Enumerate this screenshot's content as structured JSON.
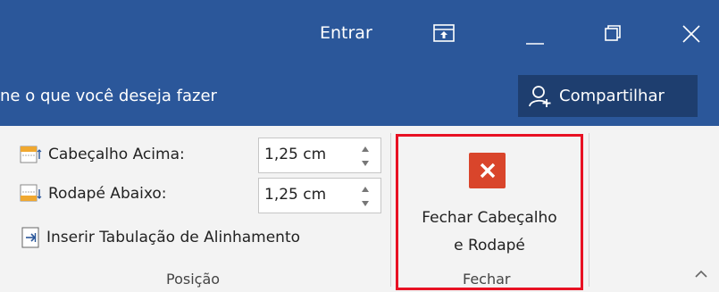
{
  "titlebar": {
    "signin_label": "Entrar",
    "icons": [
      "ribbon-display-icon",
      "minimize-icon",
      "restore-icon",
      "close-window-icon"
    ]
  },
  "tellme": {
    "text": "ne o que você deseja fazer"
  },
  "share": {
    "label": "Compartilhar",
    "icon": "person-add-icon"
  },
  "position_group": {
    "header_top_label": "Cabeçalho Acima:",
    "header_top_value": "1,25 cm",
    "footer_bottom_label": "Rodapé Abaixo:",
    "footer_bottom_value": "1,25 cm",
    "insert_tab_label": "Inserir Tabulação de Alinhamento",
    "group_label": "Posição"
  },
  "close_group": {
    "button_line1": "Fechar Cabeçalho",
    "button_line2": "e Rodapé",
    "group_label": "Fechar",
    "accent": "#d9452b",
    "highlight_color": "#e81123"
  },
  "colors": {
    "title_bg": "#2b579a",
    "share_bg": "#1e3e6f",
    "ribbon_bg": "#f3f3f3"
  }
}
